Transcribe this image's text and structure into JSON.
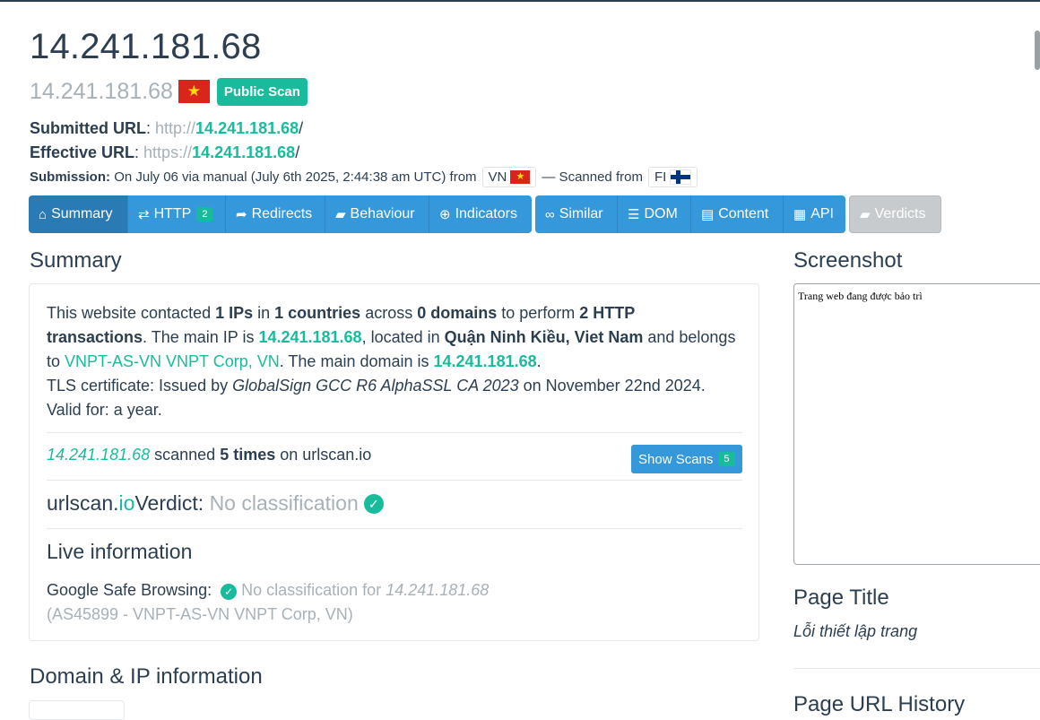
{
  "header": {
    "title": "14.241.181.68",
    "subtitle": "14.241.181.68",
    "badge": "Public Scan"
  },
  "urls": {
    "submitted_label": "Submitted URL",
    "submitted_scheme": "http://",
    "submitted_host": "14.241.181.68",
    "submitted_path": "/",
    "effective_label": "Effective URL",
    "effective_scheme": "https://",
    "effective_host": "14.241.181.68",
    "effective_path": "/"
  },
  "submission": {
    "label": "Submission:",
    "text": "On July 06 via manual (July 6th 2025, 2:44:38 am UTC) from",
    "country": "VN",
    "scanned_from": "— Scanned from",
    "scan_country": "FI"
  },
  "nav": {
    "summary": "Summary",
    "http": "HTTP",
    "http_count": "2",
    "redirects": "Redirects",
    "behaviour": "Behaviour",
    "indicators": "Indicators",
    "similar": "Similar",
    "dom": "DOM",
    "content": "Content",
    "api": "API",
    "verdicts": "Verdicts"
  },
  "summary": {
    "heading": "Summary",
    "p1_a": "This website contacted ",
    "ips": "1 IPs",
    "p1_b": " in ",
    "countries": "1 countries",
    "p1_c": " across ",
    "domains": "0 domains",
    "p1_d": " to perform ",
    "transactions": "2 HTTP transactions",
    "p1_e": ". The main IP is ",
    "main_ip": "14.241.181.68",
    "p1_f": ", located in ",
    "location": "Quận Ninh Kiều, Viet Nam",
    "p1_g": " and belongs to ",
    "asn": "VNPT-AS-VN VNPT Corp, VN",
    "p1_h": ". The main domain is ",
    "main_domain": "14.241.181.68",
    "p1_i": ".",
    "tls_a": "TLS certificate: Issued by ",
    "tls_issuer": "GlobalSign GCC R6 AlphaSSL CA 2023",
    "tls_b": " on November 22nd 2024. Valid for: a year.",
    "scanned_ip": "14.241.181.68",
    "scanned_a": " scanned ",
    "scanned_times": "5 times",
    "scanned_b": " on urlscan.io",
    "show_scans": "Show Scans",
    "show_scans_count": "5",
    "verdict_a": "urlscan.",
    "verdict_io": "io",
    "verdict_b": " Verdict: ",
    "verdict_value": "No classification",
    "live_title": "Live information",
    "gsb_label": "Google Safe Browsing:",
    "gsb_value": "No classification for ",
    "gsb_ip": "14.241.181.68",
    "gsb_asn": "(AS45899 - VNPT-AS-VN VNPT Corp, VN)"
  },
  "right": {
    "screenshot_heading": "Screenshot",
    "screenshot_text": "Trang web đang được bảo trì",
    "page_title_heading": "Page Title",
    "page_title_value": "Lỗi thiết lập trang",
    "url_history_heading": "Page URL History"
  },
  "domain_heading": "Domain & IP information",
  "colors": {
    "primary": "#3498db",
    "primary_active": "#2a7ab6",
    "success": "#18bc9c",
    "text": "#2c3e50",
    "muted": "#a7b1b7"
  }
}
